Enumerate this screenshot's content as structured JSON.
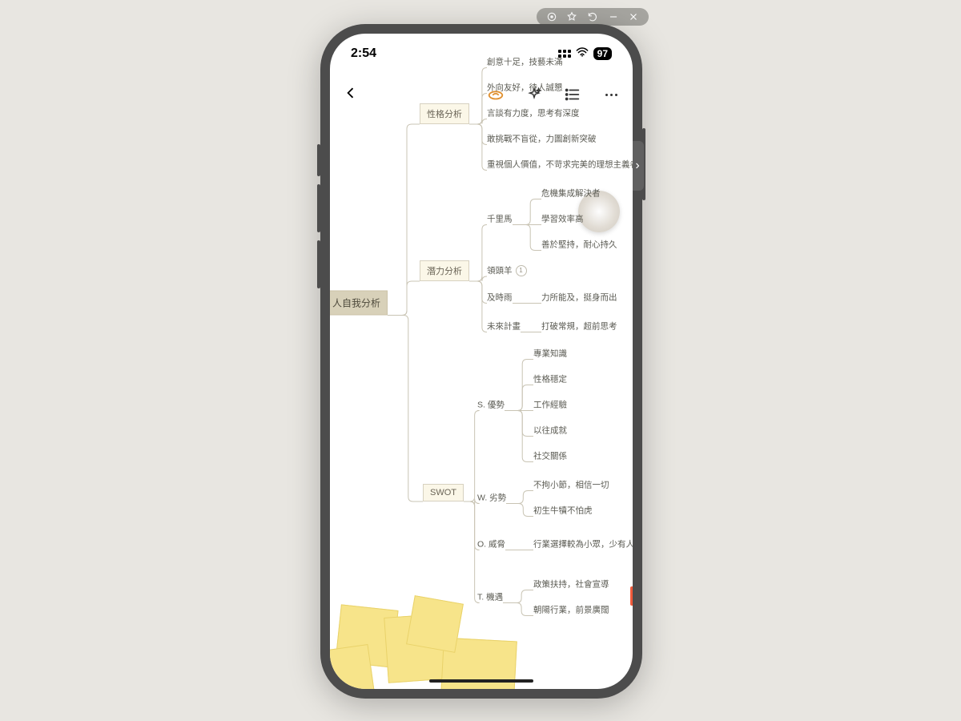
{
  "overlay": {
    "icons": [
      "record",
      "star",
      "undo",
      "minimize",
      "close"
    ]
  },
  "status": {
    "time": "2:54",
    "battery": "97"
  },
  "mindmap": {
    "root": "人自我分析",
    "branches": [
      {
        "label": "性格分析",
        "children": [
          {
            "label": "創意十足，技藝未滿"
          },
          {
            "label": "外向友好，待人誠懇"
          },
          {
            "label": "言談有力度，思考有深度"
          },
          {
            "label": "敢挑戰不盲從，力圖創新突破"
          },
          {
            "label": "重視個人價值，不苛求完美的理想主義者"
          }
        ]
      },
      {
        "label": "潛力分析",
        "children": [
          {
            "label": "千里馬",
            "children": [
              {
                "label": "危機集成解決者"
              },
              {
                "label": "學習效率高"
              },
              {
                "label": "善於堅持，耐心持久"
              }
            ]
          },
          {
            "label": "領頭羊",
            "badge": "1"
          },
          {
            "label": "及時雨",
            "children": [
              {
                "label": "力所能及，挺身而出"
              }
            ]
          },
          {
            "label": "未來計畫",
            "children": [
              {
                "label": "打破常規，超前思考"
              }
            ]
          }
        ]
      },
      {
        "label": "SWOT",
        "children": [
          {
            "label": "S. 優勢",
            "children": [
              {
                "label": "專業知識"
              },
              {
                "label": "性格穩定"
              },
              {
                "label": "工作經驗"
              },
              {
                "label": "以往成就"
              },
              {
                "label": "社交關係"
              }
            ]
          },
          {
            "label": "W. 劣勢",
            "children": [
              {
                "label": "不拘小節，相信一切"
              },
              {
                "label": "初生牛犢不怕虎"
              }
            ]
          },
          {
            "label": "O. 威脅",
            "children": [
              {
                "label": "行業選擇較為小眾，少有人走的"
              }
            ]
          },
          {
            "label": "T. 機遇",
            "children": [
              {
                "label": "政策扶持，社會宣導"
              },
              {
                "label": "朝陽行業，前景廣闊"
              }
            ]
          }
        ]
      }
    ]
  }
}
